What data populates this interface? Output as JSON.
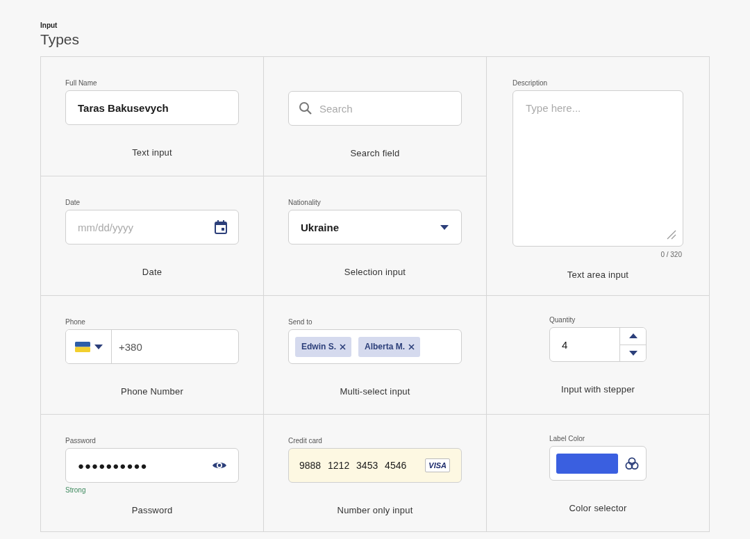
{
  "header": {
    "eyebrow": "Input",
    "title": "Types"
  },
  "cells": [
    {
      "kind": "text",
      "label": "Full Name",
      "value": "Taras Bakusevych",
      "caption": "Text input"
    },
    {
      "kind": "search",
      "placeholder": "Search",
      "caption": "Search field"
    },
    {
      "kind": "textarea",
      "label": "Description",
      "placeholder": "Type here...",
      "counter": "0 / 320",
      "caption": "Text area input"
    },
    {
      "kind": "date",
      "label": "Date",
      "placeholder": "mm/dd/yyyy",
      "caption": "Date"
    },
    {
      "kind": "select",
      "label": "Nationality",
      "value": "Ukraine",
      "caption": "Selection input"
    },
    {
      "kind": "phone",
      "label": "Phone",
      "value": "+380",
      "caption": "Phone Number"
    },
    {
      "kind": "multi",
      "label": "Send to",
      "chips": [
        "Edwin S.",
        "Alberta M."
      ],
      "caption": "Multi-select input"
    },
    {
      "kind": "stepper",
      "label": "Quantity",
      "value": "4",
      "caption": "Input with stepper"
    },
    {
      "kind": "password",
      "label": "Password",
      "value": "●●●●●●●●●●",
      "strength": "Strong",
      "caption": "Password"
    },
    {
      "kind": "card",
      "label": "Credit card",
      "value": "9888 1212 3453 4546",
      "brand": "VISA",
      "caption": "Number only input"
    },
    {
      "kind": "color",
      "label": "Label Color",
      "color": "#3a5fe0",
      "caption": "Color selector"
    }
  ]
}
